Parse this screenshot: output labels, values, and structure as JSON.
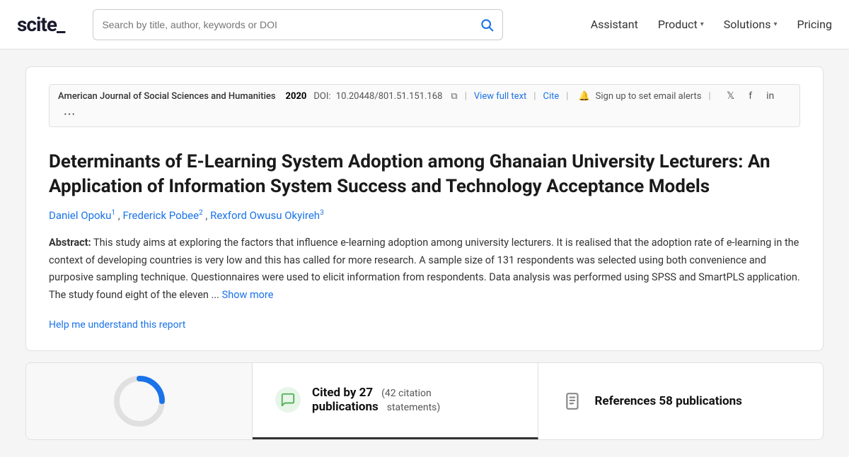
{
  "nav": {
    "logo": "scite_",
    "search_placeholder": "Search by title, author, keywords or DOI",
    "links": [
      {
        "label": "Assistant",
        "has_chevron": false
      },
      {
        "label": "Product",
        "has_chevron": true
      },
      {
        "label": "Solutions",
        "has_chevron": true
      },
      {
        "label": "Pricing",
        "has_chevron": false
      }
    ]
  },
  "article": {
    "journal": "American Journal of Social Sciences and Humanities",
    "year": "2020",
    "doi_label": "DOI:",
    "doi_value": "10.20448/801.51.151.168",
    "view_full_text": "View full text",
    "cite_label": "Cite",
    "alert_label": "Sign up to set email alerts",
    "title": "Determinants of E-Learning System Adoption among Ghanaian University Lecturers: An Application of Information System Success and Technology Acceptance Models",
    "authors": [
      {
        "name": "Daniel Opoku",
        "sup": "1"
      },
      {
        "name": "Frederick Pobee",
        "sup": "2"
      },
      {
        "name": "Rexford Owusu Okyireh",
        "sup": "3"
      }
    ],
    "abstract_label": "Abstract:",
    "abstract_text": "This study aims at exploring the factors that influence e-learning adoption among university lecturers. It is realised that the adoption rate of e-learning in the context of developing countries is very low and this has called for more research. A sample size of 131 respondents was selected using both convenience and purposive sampling technique. Questionnaires were used to elicit information from respondents. Data analysis was performed using SPSS and SmartPLS application. The study found eight of the eleven ...",
    "show_more": "Show more",
    "help_text": "Help me understand this report"
  },
  "bottom": {
    "cited_main": "Cited by 27",
    "cited_sub_part1": "publications",
    "cited_statements": "(42 citation",
    "cited_statements2": "statements)",
    "refs_label": "References 58 publications"
  }
}
